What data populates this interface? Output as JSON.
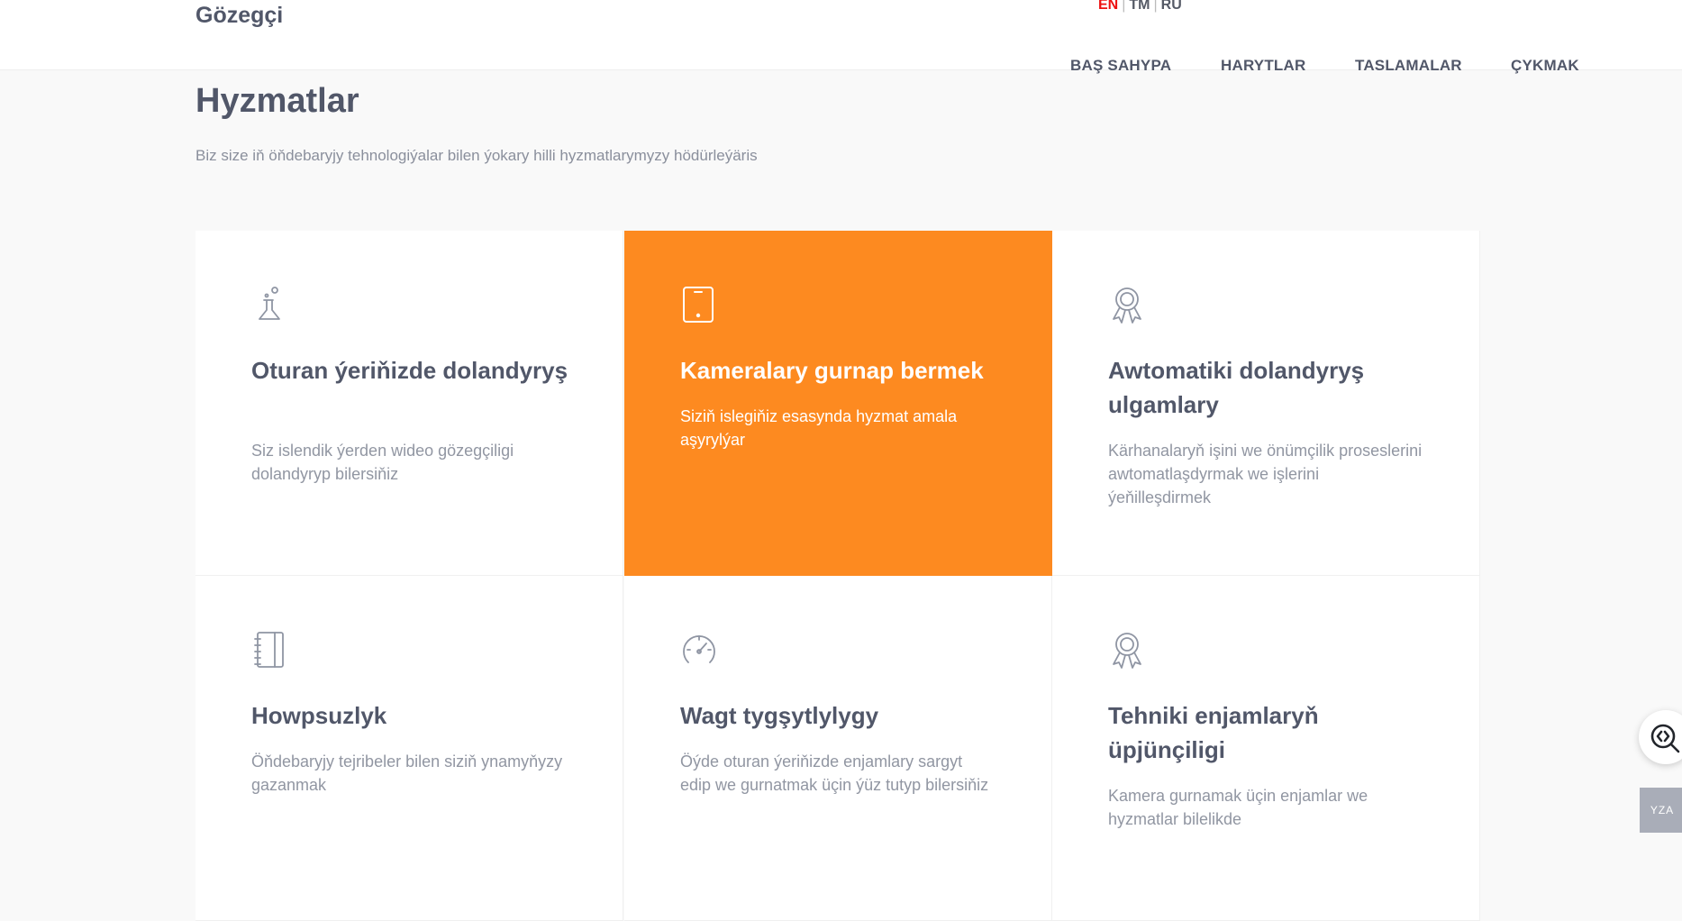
{
  "header": {
    "logo": "Gözegçi",
    "languages": [
      "EN",
      "TM",
      "RU"
    ],
    "active_language": "EN",
    "nav": [
      "BAŞ SAHYPA",
      "HARYTLAR",
      "TASLAMALAR",
      "ÇYKMAK"
    ]
  },
  "section": {
    "title": "Hyzmatlar",
    "subtitle": "Biz size iň öňdebaryjy tehnologiýalar bilen ýokary hilli hyzmatlarymyzy hödürleýäris"
  },
  "services": [
    {
      "icon": "flask-icon",
      "title": "Oturan ýeriňizde dolandyryş",
      "description": "Siz islendik ýerden wideo gözegçiligi dolandyryp bilersiňiz"
    },
    {
      "icon": "tablet-icon",
      "title": "Kameralary gurnap bermek",
      "description": "Siziň islegiňiz esasynda hyzmat amala aşyrylýar"
    },
    {
      "icon": "award-icon",
      "title": "Awtomatiki dolandyryş ulgamlary",
      "description": "Kärhanalaryň işini we önümçilik proseslerini awtomatlaşdyrmak we işlerini ýeňilleşdirmek"
    },
    {
      "icon": "notebook-icon",
      "title": "Howpsuzlyk",
      "description": "Öňdebaryjy tejribeler bilen siziň ynamyňyzy gazanmak"
    },
    {
      "icon": "speedometer-icon",
      "title": "Wagt tygşytlylygy",
      "description": "Öýde oturan ýeriňizde enjamlary sargyt edip we gurnatmak üçin ýüz tutyp bilersiňiz"
    },
    {
      "icon": "award-icon",
      "title": "Tehniki enjamlaryň üpjünçiligi",
      "description": "Kamera gurnamak üçin enjamlar we hyzmatlar bilelikde"
    }
  ],
  "widget": {
    "badge": "YZA"
  },
  "colors": {
    "accent": "#fd8a20",
    "active_language": "#ee1111",
    "text": "#515769"
  }
}
